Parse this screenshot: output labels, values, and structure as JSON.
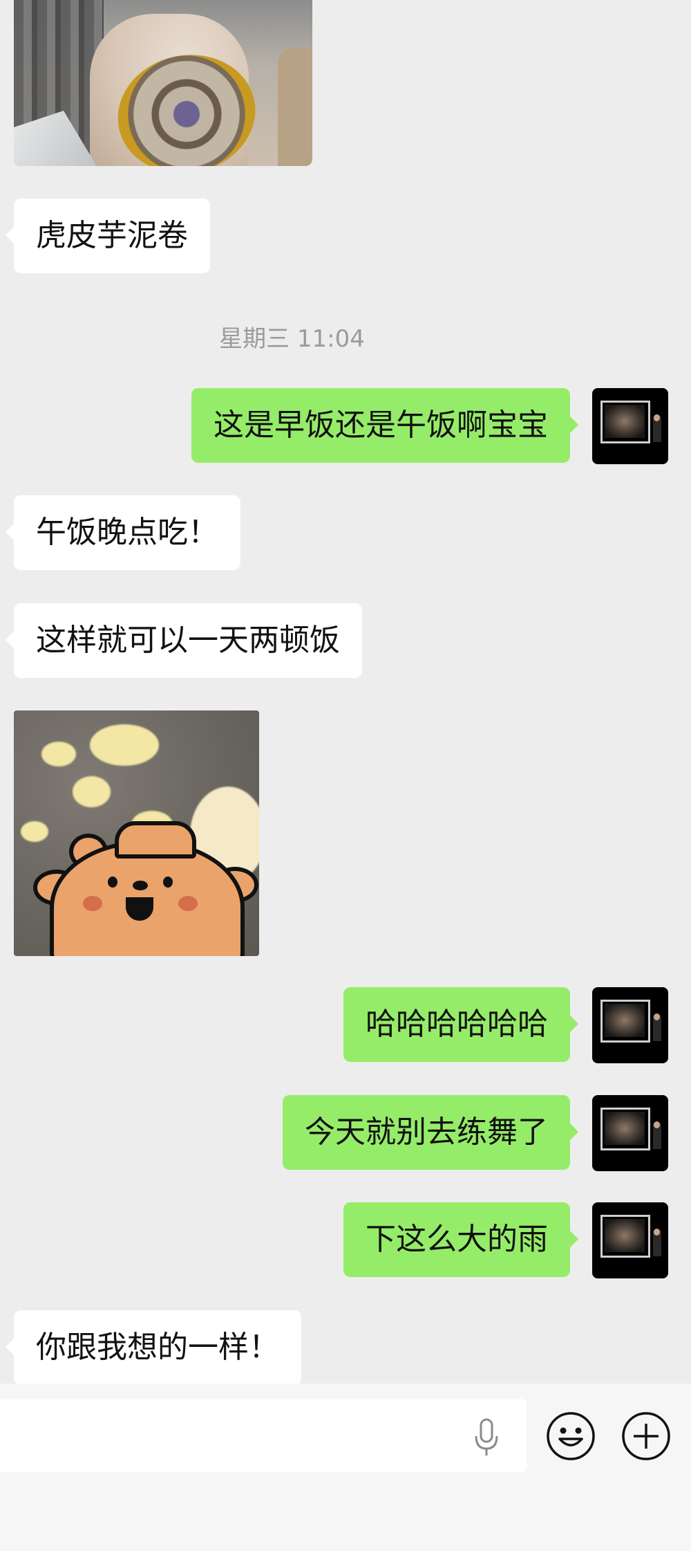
{
  "conversation": {
    "timestamp": "星期三 11:04",
    "messages": [
      {
        "side": "in",
        "type": "image",
        "label": "photo"
      },
      {
        "side": "in",
        "text": "虎皮芋泥卷"
      },
      {
        "side": "out",
        "text": "这是早饭还是午饭啊宝宝"
      },
      {
        "side": "in",
        "text": "午饭晚点吃！"
      },
      {
        "side": "in",
        "text": "这样就可以一天两顿饭"
      },
      {
        "side": "in",
        "type": "sticker",
        "label": "bear sticker"
      },
      {
        "side": "out",
        "text": "哈哈哈哈哈哈"
      },
      {
        "side": "out",
        "text": "今天就别去练舞了"
      },
      {
        "side": "out",
        "text": "下这么大的雨"
      },
      {
        "side": "in",
        "text": "你跟我想的一样！"
      }
    ]
  },
  "input_bar": {
    "voice_icon": "microphone-icon",
    "emoji_icon": "smiley-icon",
    "more_icon": "plus-circle-icon"
  },
  "colors": {
    "background": "#ededed",
    "incoming_bubble": "#ffffff",
    "outgoing_bubble": "#95ec69",
    "timestamp_text": "#9a9a9a"
  }
}
